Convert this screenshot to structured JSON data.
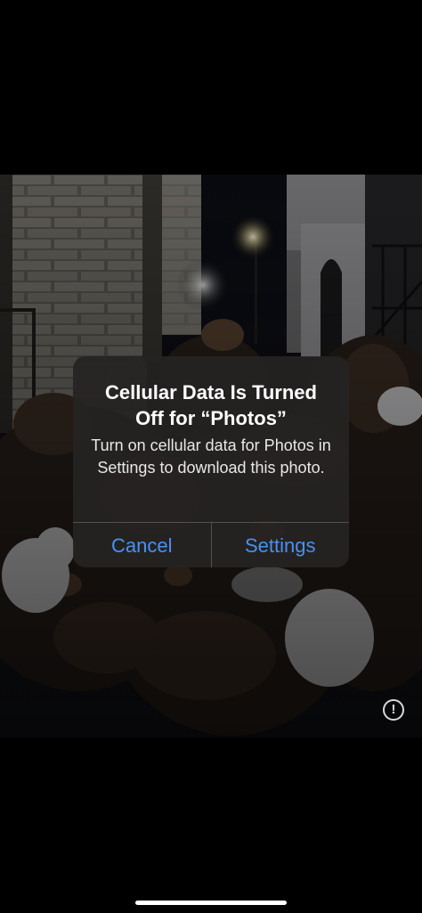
{
  "alert": {
    "title": "Cellular Data Is Turned Off for “Photos”",
    "message": "Turn on cellular data for Photos in Settings to download this photo.",
    "cancel_label": "Cancel",
    "settings_label": "Settings"
  },
  "info_button": {
    "glyph": "!",
    "icon": "info-icon"
  },
  "colors": {
    "action_blue": "#4a90f2",
    "alert_bg": "#262422"
  }
}
